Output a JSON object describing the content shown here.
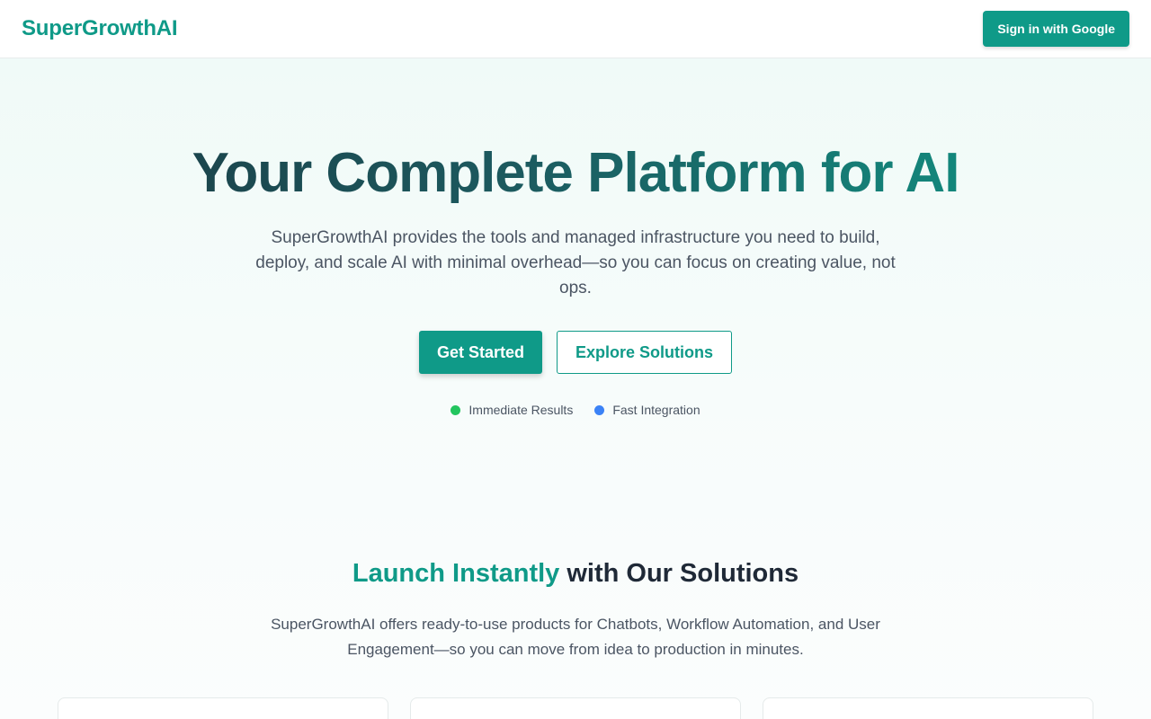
{
  "header": {
    "logo": "SuperGrowthAI",
    "signin_label": "Sign in with Google"
  },
  "hero": {
    "title": "Your Complete Platform for AI",
    "subtitle": "SuperGrowthAI provides the tools and managed infrastructure you need to build, deploy, and scale AI with minimal overhead—so you can focus on creating value, not ops.",
    "primary_cta": "Get Started",
    "secondary_cta": "Explore Solutions",
    "badges": [
      {
        "label": "Immediate Results",
        "color": "#22c55e"
      },
      {
        "label": "Fast Integration",
        "color": "#3b82f6"
      }
    ]
  },
  "solutions": {
    "title_accent": "Launch Instantly",
    "title_rest": " with Our Solutions",
    "subtitle": "SuperGrowthAI offers ready-to-use products for Chatbots, Workflow Automation, and User Engagement—so you can move from idea to production in minutes."
  },
  "colors": {
    "brand": "#0f9a88",
    "heading_dark": "#1a3a43"
  }
}
